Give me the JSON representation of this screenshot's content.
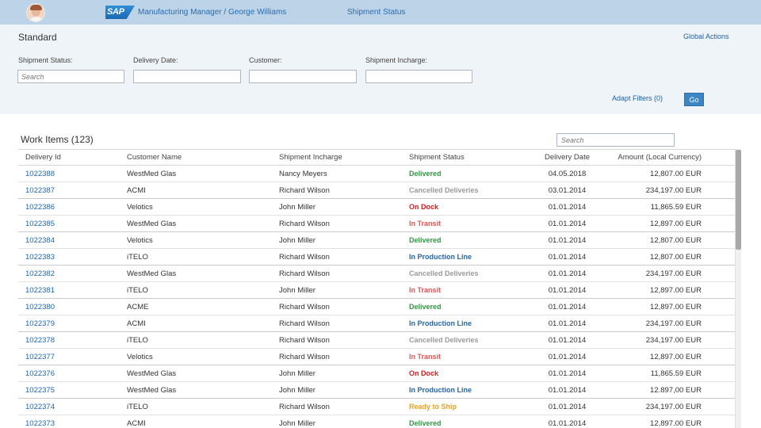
{
  "shell": {
    "app_title": "Manufacturing Manager / George Williams",
    "page_title": "Shipment Status",
    "logo_text": "SAP"
  },
  "filter": {
    "variant": "Standard",
    "global_actions": "Global Actions",
    "labels": [
      "Shipment Status:",
      "Delivery Date:",
      "Customer:",
      "Shipment Incharge:"
    ],
    "search_placeholder": "Search",
    "adapt_filters": "Adapt Filters (0)",
    "go": "Go"
  },
  "table": {
    "title": "Work Items (123)",
    "search_placeholder": "Search",
    "columns": [
      "Delivery Id",
      "Customer Name",
      "Shipment Incharge",
      "Shipment Status",
      "Delivery Date",
      "Amount (Local Currency)"
    ],
    "rows": [
      {
        "id": "1022388",
        "customer": "WestMed Glas",
        "incharge": "Nancy Meyers",
        "status": "Delivered",
        "date": "04.05.2018",
        "amount": "12,807.00 EUR",
        "color": "#2b9a3e"
      },
      {
        "id": "1022387",
        "customer": "ACMI",
        "incharge": "Richard Wilson",
        "status": "Cancelled Deliveries",
        "date": "03.01.2014",
        "amount": "234,197.00 EUR",
        "color": "#9a9a9a"
      },
      {
        "id": "1022386",
        "customer": "Velotics",
        "incharge": "John Miller",
        "status": "On Dock",
        "date": "01.01.2014",
        "amount": "11,865.59 EUR",
        "color": "#cc1f1f"
      },
      {
        "id": "1022385",
        "customer": "WestMed Glas",
        "incharge": "Richard Wilson",
        "status": "In Transit",
        "date": "01.01.2014",
        "amount": "12,897.00 EUR",
        "color": "#e05555"
      },
      {
        "id": "1022384",
        "customer": "Velotics",
        "incharge": "John Miller",
        "status": "Delivered",
        "date": "01.01.2014",
        "amount": "12,807.00 EUR",
        "color": "#2b9a3e"
      },
      {
        "id": "1022383",
        "customer": "iTELO",
        "incharge": "Richard Wilson",
        "status": "In Production Line",
        "date": "01.01.2014",
        "amount": "12,807.00 EUR",
        "color": "#1f67ab"
      },
      {
        "id": "1022382",
        "customer": "WestMed Glas",
        "incharge": "Richard Wilson",
        "status": "Cancelled Deliveries",
        "date": "01.01.2014",
        "amount": "234,197.00 EUR",
        "color": "#9a9a9a"
      },
      {
        "id": "1022381",
        "customer": "iTELO",
        "incharge": "John Miller",
        "status": "In Transit",
        "date": "01.01.2014",
        "amount": "12,897.00 EUR",
        "color": "#e05555"
      },
      {
        "id": "1022380",
        "customer": "ACME",
        "incharge": "Richard Wilson",
        "status": "Delivered",
        "date": "01.01.2014",
        "amount": "12,897.00 EUR",
        "color": "#2b9a3e"
      },
      {
        "id": "1022379",
        "customer": "ACMI",
        "incharge": "Richard Wilson",
        "status": "In Production Line",
        "date": "01.01.2014",
        "amount": "234,197.00 EUR",
        "color": "#1f67ab"
      },
      {
        "id": "1022378",
        "customer": "iTELO",
        "incharge": "Richard Wilson",
        "status": "Cancelled Deliveries",
        "date": "01.01.2014",
        "amount": "234,197.00 EUR",
        "color": "#9a9a9a"
      },
      {
        "id": "1022377",
        "customer": "Velotics",
        "incharge": "Richard Wilson",
        "status": "In Transit",
        "date": "01.01.2014",
        "amount": "12,897.00 EUR",
        "color": "#e05555"
      },
      {
        "id": "1022376",
        "customer": "WestMed Glas",
        "incharge": "John Miller",
        "status": "On Dock",
        "date": "01.01.2014",
        "amount": "11,865.59 EUR",
        "color": "#cc1f1f"
      },
      {
        "id": "1022375",
        "customer": "WestMed Glas",
        "incharge": "John Miller",
        "status": "In Production Line",
        "date": "01.01.2014",
        "amount": "12.897,00 EUR",
        "color": "#1f67ab"
      },
      {
        "id": "1022374",
        "customer": "iTELO",
        "incharge": "Richard Wilson",
        "status": "Ready to Ship",
        "date": "01.01.2014",
        "amount": "234,197.00 EUR",
        "color": "#e8a317"
      },
      {
        "id": "1022373",
        "customer": "ACMI",
        "incharge": "John Miller",
        "status": "Delivered",
        "date": "01.01.2014",
        "amount": "12,897.00 EUR",
        "color": "#2b9a3e"
      }
    ]
  }
}
